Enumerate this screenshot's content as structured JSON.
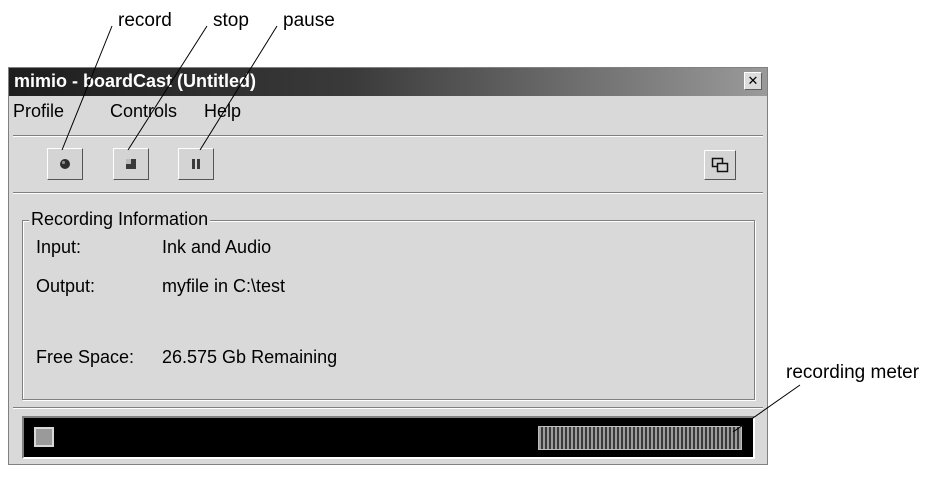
{
  "callouts": {
    "record": "record",
    "stop": "stop",
    "pause": "pause",
    "recording_meter": "recording meter"
  },
  "window": {
    "title": "mimio - boardCast (Untitled)",
    "close_glyph": "✕"
  },
  "menu": {
    "items": [
      "Profile",
      "Controls",
      "Help"
    ]
  },
  "toolbar": {
    "buttons": [
      {
        "icon": "record-icon"
      },
      {
        "icon": "stop-icon"
      },
      {
        "icon": "pause-icon"
      },
      {
        "icon": "restore-window-icon"
      }
    ]
  },
  "recording_info": {
    "legend": "Recording Information",
    "rows": [
      {
        "label": "Input:",
        "value": "Ink and Audio"
      },
      {
        "label": "Output:",
        "value": "myfile in C:\\test"
      },
      {
        "label": "Free Space:",
        "value": "26.575 Gb Remaining"
      }
    ]
  },
  "colors": {
    "window_bg": "#d9d9d9",
    "meter_bg": "#000000"
  }
}
